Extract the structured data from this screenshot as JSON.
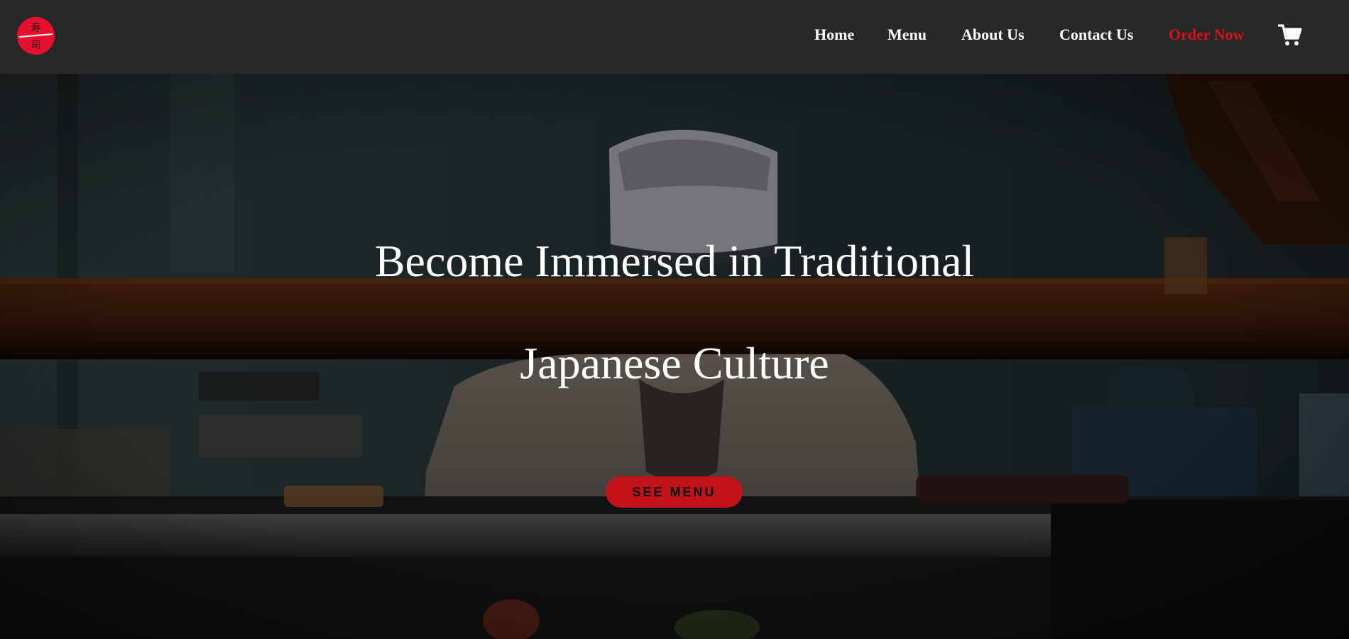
{
  "nav": {
    "logo_glyphs": "寿司",
    "items": [
      {
        "label": "Home"
      },
      {
        "label": "Menu"
      },
      {
        "label": "About Us"
      },
      {
        "label": "Contact Us"
      },
      {
        "label": "Order Now"
      }
    ],
    "cart_icon": "shopping-cart-icon"
  },
  "hero": {
    "title_line1": "Become Immersed in Traditional",
    "title_line2": "Japanese Culture",
    "cta_label": "SEE MENU"
  },
  "colors": {
    "nav_bg": "#282828",
    "accent_red": "#d2141e",
    "button_red": "#c21318",
    "logo_red": "#e8102f",
    "text_white": "#ffffff"
  }
}
